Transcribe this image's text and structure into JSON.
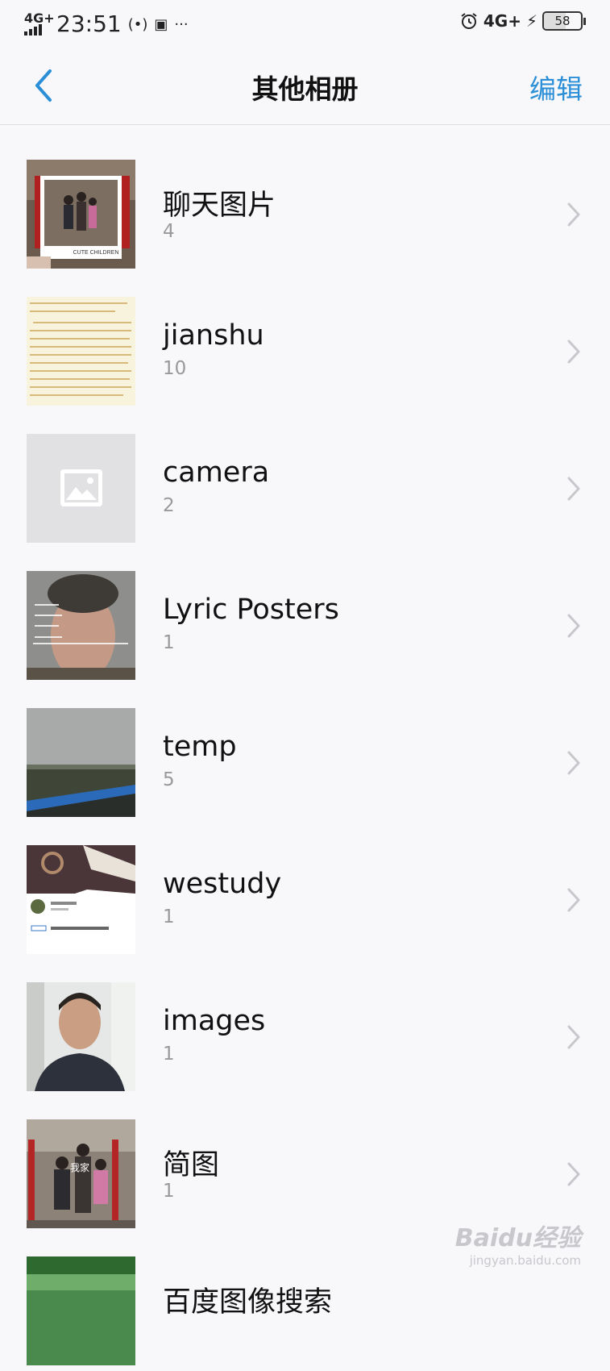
{
  "status_bar": {
    "network_left": "4G+",
    "time": "23:51",
    "network_right": "4G+",
    "battery": "58",
    "battery_level": 0.58
  },
  "navbar": {
    "title": "其他相册",
    "edit_label": "编辑"
  },
  "albums": [
    {
      "name": "聊天图片",
      "count": "4",
      "thumb_caption": "CUTE CHILDREN"
    },
    {
      "name": "jianshu",
      "count": "10"
    },
    {
      "name": "camera",
      "count": "2"
    },
    {
      "name": "Lyric Posters",
      "count": "1"
    },
    {
      "name": "temp",
      "count": "5"
    },
    {
      "name": "westudy",
      "count": "1"
    },
    {
      "name": "images",
      "count": "1"
    },
    {
      "name": "简图",
      "count": "1",
      "thumb_caption": "我家"
    },
    {
      "name": "百度图像搜索",
      "count": ""
    }
  ],
  "watermark": {
    "logo": "Baidu经验",
    "url": "jingyan.baidu.com"
  },
  "colors": {
    "accent": "#2b8fd8",
    "background": "#f8f7fa"
  }
}
